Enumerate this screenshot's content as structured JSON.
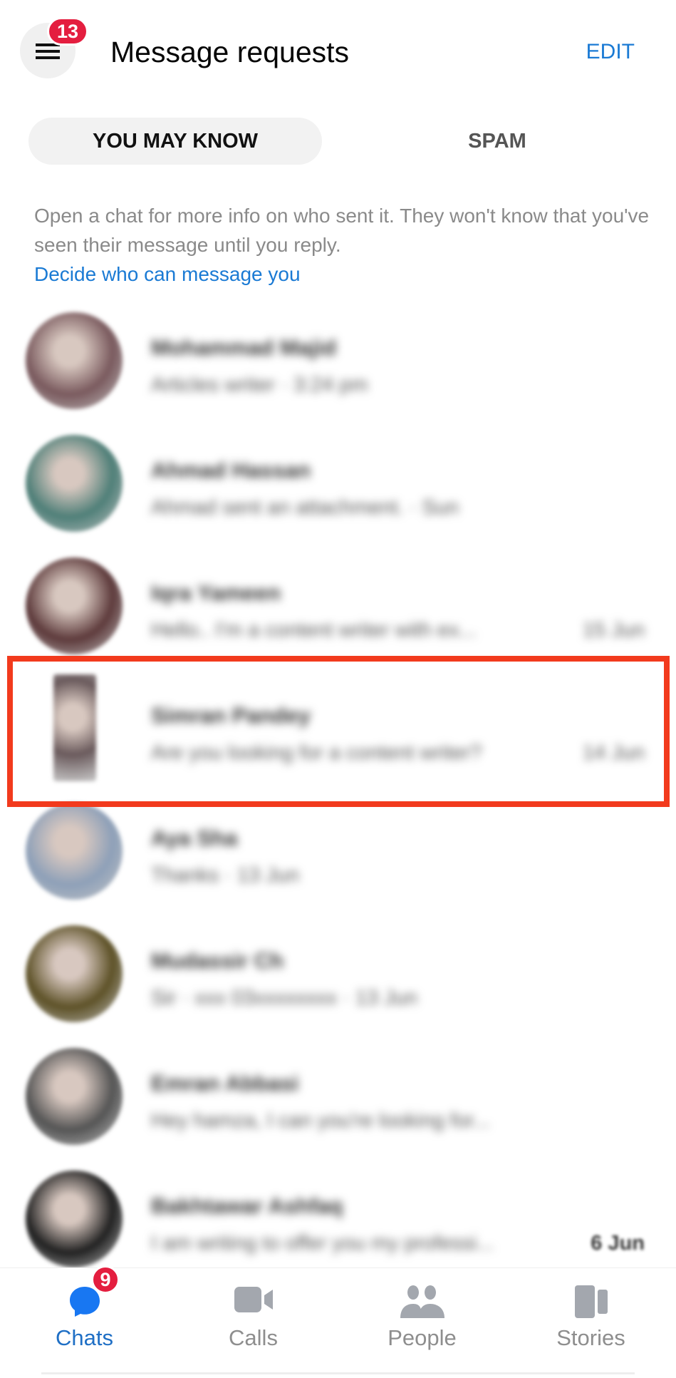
{
  "header": {
    "menu_badge": "13",
    "title": "Message requests",
    "edit_label": "EDIT"
  },
  "tabs": [
    {
      "label": "YOU MAY KNOW",
      "active": true
    },
    {
      "label": "SPAM",
      "active": false
    }
  ],
  "info": {
    "text": "Open a chat for more info on who sent it. They won't know that you've seen their message until you reply.",
    "link": "Decide who can message you"
  },
  "requests": [
    {
      "name": "Mohammad Majid",
      "preview": "Articles writer · 3:24 pm",
      "time": "",
      "avatar": "#7a5a5e"
    },
    {
      "name": "Ahmad Hassan",
      "preview": "Ahmad sent an attachment. · Sun",
      "time": "",
      "avatar": "#4f7f78"
    },
    {
      "name": "Iqra Yameen",
      "preview": "Hello.. I'm a content writer with ex...",
      "time": "15 Jun",
      "avatar": "#5e3b3c"
    },
    {
      "name": "Simran Pandey",
      "preview": "Are you looking for a content writer?",
      "time": "14 Jun",
      "avatar": "#6a5a5c",
      "highlighted": true
    },
    {
      "name": "Aya Sha",
      "preview": "Thanks · 13 Jun",
      "time": "",
      "avatar": "#8ea0b8"
    },
    {
      "name": "Mudassir Ch",
      "preview": "Sir · xxx 03xxxxxxxx · 13 Jun",
      "time": "",
      "avatar": "#5e5228"
    },
    {
      "name": "Emran Abbasi",
      "preview": "Hey hamza, I can you're looking for...",
      "time": "",
      "avatar": "#555555"
    },
    {
      "name": "Bakhtawar Ashfaq",
      "preview": "I am writing to offer you my professi...",
      "time": "6 Jun",
      "avatar": "#222222"
    }
  ],
  "nav": [
    {
      "label": "Chats",
      "icon": "chat-bubble-icon",
      "badge": "9",
      "active": true
    },
    {
      "label": "Calls",
      "icon": "video-camera-icon"
    },
    {
      "label": "People",
      "icon": "people-icon"
    },
    {
      "label": "Stories",
      "icon": "stories-icon"
    }
  ],
  "colors": {
    "accent": "#1a7ad4",
    "badge": "#e41e3f",
    "highlight": "#f23a1d"
  }
}
